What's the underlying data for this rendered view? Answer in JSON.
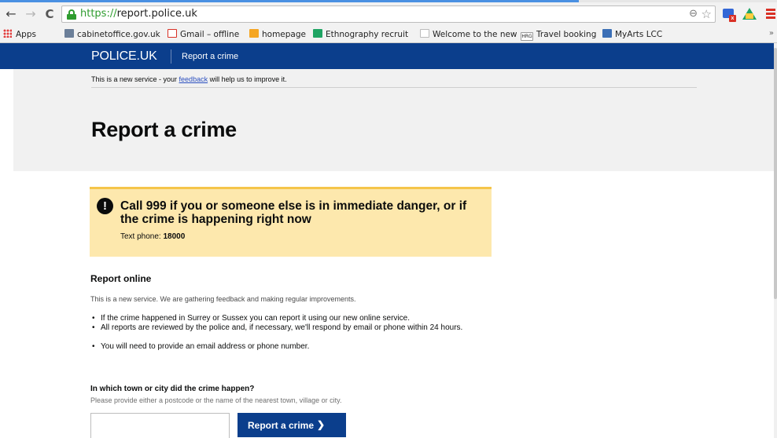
{
  "browser": {
    "url_scheme": "https://",
    "url_host": "report.police.uk",
    "nav": {
      "back": "←",
      "forward": "→",
      "reload": "C"
    },
    "zoom_glyph": "⊖",
    "star_glyph": "☆",
    "bookmarks": [
      {
        "label": "Apps",
        "icon": "apps-grid-icon"
      },
      {
        "label": "cabinetoffice.gov.uk",
        "icon": "folder-icon",
        "color": "#6b7f99"
      },
      {
        "label": "Gmail – offline",
        "icon": "gmail-icon",
        "color": "#d93025"
      },
      {
        "label": "homepage",
        "icon": "homepage-icon",
        "color": "#f5a623"
      },
      {
        "label": "Ethnography recruit",
        "icon": "sheets-icon",
        "color": "#1fa463"
      },
      {
        "label": "Welcome to the new",
        "icon": "page-icon",
        "color": "#cfcfcf"
      },
      {
        "label": "Travel booking",
        "icon": "hrg-icon",
        "badge": "HRG"
      },
      {
        "label": "MyArts LCC",
        "icon": "myarts-icon",
        "color": "#3b6fb6"
      }
    ],
    "bookmarks_more": "»"
  },
  "header": {
    "logo": "POLICE.UK",
    "service": "Report a crime"
  },
  "phase_banner": {
    "before": "This is a new service - your ",
    "link": "feedback",
    "after": " will help us to improve it."
  },
  "page_title": "Report a crime",
  "warning": {
    "icon": "!",
    "heading": "Call 999 if you or someone else is in immediate danger, or if the crime is happening right now",
    "text_phone_label": "Text phone: ",
    "text_phone_number": "18000"
  },
  "report_online": {
    "heading": "Report online",
    "lead": "This is a new service. We are gathering feedback and making regular improvements.",
    "bullets": [
      "If the crime happened in Surrey or Sussex you can report it using our new online service.",
      "All reports are reviewed by the police and, if necessary, we'll respond by email or phone within 24 hours.",
      "You will need to provide an email address or phone number."
    ]
  },
  "location_question": {
    "label": "In which town or city did the crime happen?",
    "hint": "Please provide either a postcode or the name of the nearest town, village or city.",
    "value": "",
    "placeholder": ""
  },
  "submit": {
    "label": "Report a crime",
    "chevron": "❯"
  }
}
